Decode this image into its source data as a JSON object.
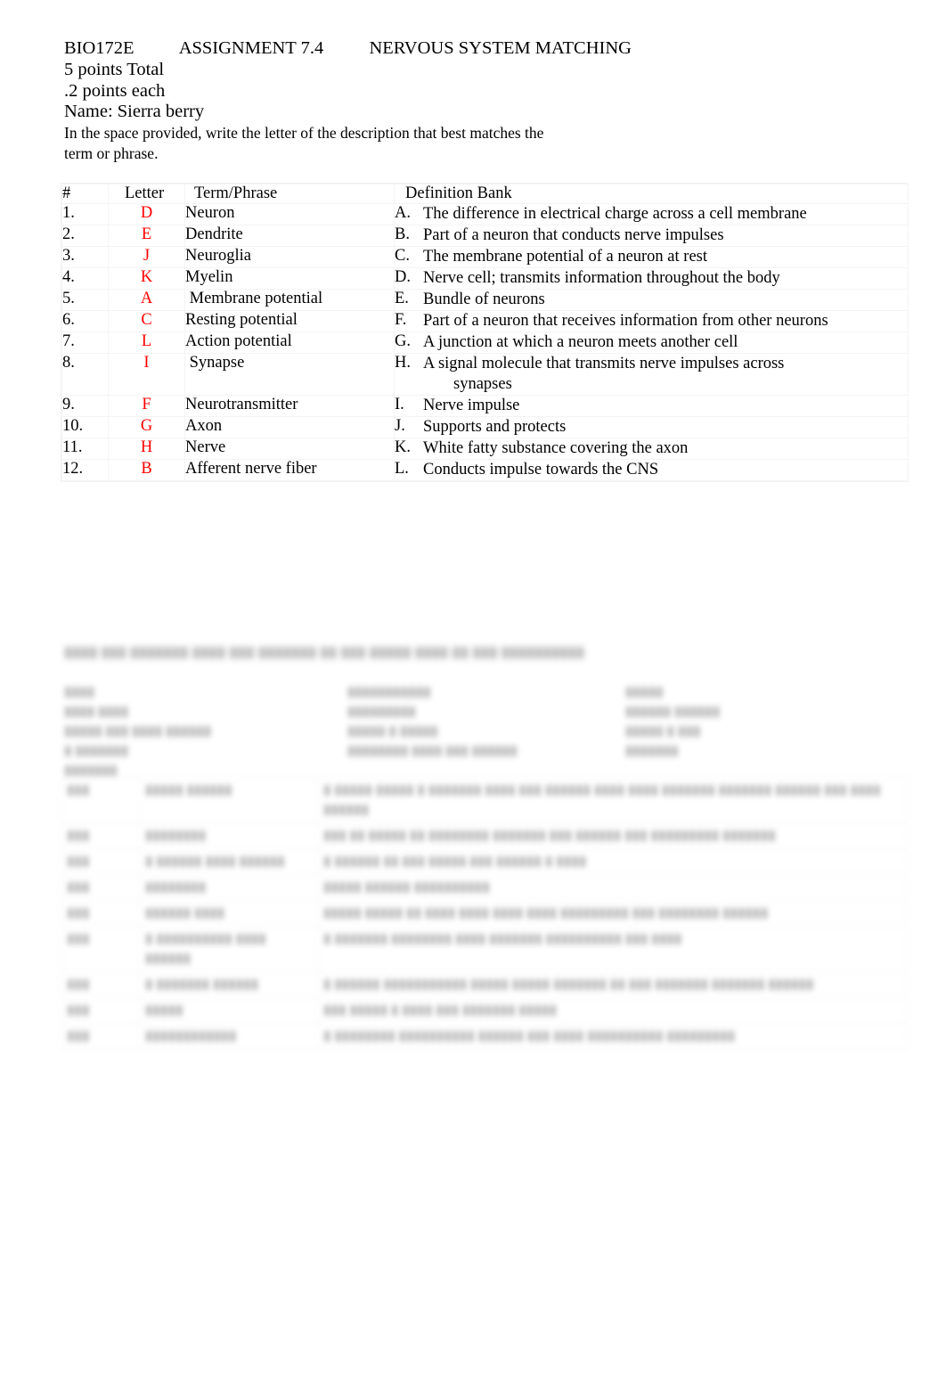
{
  "document": {
    "course_code": "BIO172E",
    "assignment": "ASSIGNMENT 7.4",
    "title": "NERVOUS SYSTEM MATCHING",
    "header_line_1": "BIO172E          ASSIGNMENT 7.4          NERVOUS SYSTEM MATCHING",
    "points_total": "5 points Total",
    "points_each": ".2 points each",
    "name_line": "Name: Sierra berry",
    "instructions_line_1": "In the space provided, write the letter of the description that best matches the",
    "instructions_line_2": "term or phrase."
  },
  "colors": {
    "answer_red": "#ff0000",
    "text_black": "#000000",
    "grid_line": "#f4f4f4"
  },
  "matching_table": {
    "headers": {
      "number": "#",
      "letter": "Letter",
      "term": "Term/Phrase",
      "definition_bank": "Definition Bank"
    },
    "rows": [
      {
        "number": "1.",
        "answer": "D",
        "term": "Neuron",
        "def_letter": "A.",
        "def_text": "The difference in electrical charge across a cell membrane",
        "def_indent": ""
      },
      {
        "number": "2.",
        "answer": "E",
        "term": "Dendrite",
        "def_letter": "B.",
        "def_text": "Part of a neuron that conducts nerve impulses",
        "def_indent": ""
      },
      {
        "number": "3.",
        "answer": "J",
        "term": "Neuroglia",
        "def_letter": "C.",
        "def_text": "The membrane potential of a neuron at rest",
        "def_indent": ""
      },
      {
        "number": "4.",
        "answer": "K",
        "term": "Myelin",
        "def_letter": "D.",
        "def_text": "Nerve cell; transmits information throughout the body",
        "def_indent": ""
      },
      {
        "number": "5.",
        "answer": "A",
        "term": " Membrane potential",
        "def_letter": "E.",
        "def_text": "Bundle of neurons",
        "def_indent": ""
      },
      {
        "number": "6.",
        "answer": "C",
        "term": "Resting potential",
        "def_letter": "F.",
        "def_text": "Part of a neuron that receives information from other neurons",
        "def_indent": ""
      },
      {
        "number": "7.",
        "answer": "L",
        "term": "Action potential",
        "def_letter": "G.",
        "def_text": "A junction at which a neuron meets another cell",
        "def_indent": ""
      },
      {
        "number": "8.",
        "answer": "I",
        "term": " Synapse",
        "def_letter": "H.",
        "def_text": "A signal molecule that transmits nerve impulses across",
        "def_indent": "synapses"
      },
      {
        "number": "9.",
        "answer": "F",
        "term": "Neurotransmitter",
        "def_letter": "I.",
        "def_text": "Nerve impulse",
        "def_indent": ""
      },
      {
        "number": "10.",
        "answer": "G",
        "term": "Axon",
        "def_letter": "J.",
        "def_text": "Supports and protects",
        "def_indent": ""
      },
      {
        "number": "11.",
        "answer": "H",
        "term": "Nerve",
        "def_letter": "K.",
        "def_text": "White fatty substance covering the axon",
        "def_indent": ""
      },
      {
        "number": "12.",
        "answer": "B",
        "term": "Afferent nerve fiber",
        "def_letter": "L.",
        "def_text": "Conducts impulse towards the CNS",
        "def_indent": ""
      }
    ]
  },
  "redacted_section": {
    "note": "▮▮▮▮ ▮▮▮ ▮▮▮▮▮▮▮ ▮▮▮▮ ▮▮▮ ▮▮▮▮▮▮▮ ▮▮ ▮▮▮ ▮▮▮▮▮ ▮▮▮▮ ▮▮ ▮▮▮ ▮▮▮▮▮▮▮▮▮▮",
    "wordbank_columns": [
      {
        "lines": [
          "▮▮▮▮",
          "▮▮▮▮ ▮▮▮▮",
          "▮▮▮▮▮ ▮▮▮ ▮▮▮▮ ▮▮▮▮▮▮",
          "▮ ▮▮▮▮▮▮▮",
          "▮▮▮▮▮▮▮"
        ]
      },
      {
        "lines": [
          "▮▮▮▮▮▮▮▮▮▮▮",
          "▮▮▮▮▮▮▮▮▮",
          "▮▮▮▮▮ ▮ ▮▮▮▮▮",
          "▮▮▮▮▮▮▮▮ ▮▮▮▮ ▮▮▮ ▮▮▮▮▮▮"
        ]
      },
      {
        "lines": [
          "▮▮▮▮▮",
          "▮▮▮▮▮▮ ▮▮▮▮▮▮",
          "▮▮▮▮▮ ▮ ▮▮▮",
          "▮▮▮▮▮▮▮"
        ]
      }
    ],
    "table_rows": [
      {
        "c1": "▮▮▮",
        "c2": "▮▮▮▮▮ ▮▮▮▮▮▮",
        "c3": "▮ ▮▮▮▮▮ ▮▮▮▮▮ ▮ ▮▮▮▮▮▮▮ ▮▮▮▮ ▮▮▮ ▮▮▮▮▮▮ ▮▮▮▮ ▮▮▮▮ ▮▮▮▮▮▮▮ ▮▮▮▮▮▮▮ ▮▮▮▮▮▮ ▮▮▮ ▮▮▮▮ ▮▮▮▮▮▮"
      },
      {
        "c1": "▮▮▮",
        "c2": "▮▮▮▮▮▮▮▮",
        "c3": "▮▮▮ ▮▮ ▮▮▮▮▮ ▮▮ ▮▮▮▮▮▮▮▮ ▮▮▮▮▮▮▮ ▮▮▮ ▮▮▮▮▮▮ ▮▮▮ ▮▮▮▮▮▮▮▮▮ ▮▮▮▮▮▮▮"
      },
      {
        "c1": "▮▮▮",
        "c2": "▮ ▮▮▮▮▮▮ ▮▮▮▮ ▮▮▮▮▮▮",
        "c3": "▮ ▮▮▮▮▮▮ ▮▮ ▮▮▮ ▮▮▮▮▮ ▮▮▮ ▮▮▮▮▮▮ ▮ ▮▮▮▮"
      },
      {
        "c1": "▮▮▮",
        "c2": "▮▮▮▮▮▮▮▮",
        "c3": "▮▮▮▮▮ ▮▮▮▮▮▮ ▮▮▮▮▮▮▮▮▮▮"
      },
      {
        "c1": "▮▮▮",
        "c2": "▮▮▮▮▮▮ ▮▮▮▮",
        "c3": "▮▮▮▮▮ ▮▮▮▮▮ ▮▮ ▮▮▮▮ ▮▮▮▮ ▮▮▮▮ ▮▮▮▮ ▮▮▮▮▮▮▮▮▮ ▮▮▮ ▮▮▮▮▮▮▮▮ ▮▮▮▮▮▮"
      },
      {
        "c1": "▮▮▮",
        "c2": "▮ ▮▮▮▮▮▮▮▮▮▮ ▮▮▮▮ ▮▮▮▮▮▮",
        "c3": "▮ ▮▮▮▮▮▮▮ ▮▮▮▮▮▮▮▮ ▮▮▮▮ ▮▮▮▮▮▮▮ ▮▮▮▮▮▮▮▮▮▮ ▮▮▮ ▮▮▮▮"
      },
      {
        "c1": "▮▮▮",
        "c2": "▮ ▮▮▮▮▮▮▮ ▮▮▮▮▮▮",
        "c3": "▮ ▮▮▮▮▮▮ ▮▮▮▮▮▮▮▮▮▮▮ ▮▮▮▮▮ ▮▮▮▮▮ ▮▮▮▮▮▮▮ ▮▮ ▮▮▮ ▮▮▮▮▮▮▮ ▮▮▮▮▮▮▮ ▮▮▮▮▮▮"
      },
      {
        "c1": "▮▮▮",
        "c2": "▮▮▮▮▮",
        "c3": "▮▮▮ ▮▮▮▮▮ ▮ ▮▮▮▮ ▮▮▮ ▮▮▮▮▮▮▮ ▮▮▮▮▮"
      },
      {
        "c1": "▮▮▮",
        "c2": "▮▮▮▮▮▮▮▮▮▮▮▮",
        "c3": "▮ ▮▮▮▮▮▮▮▮ ▮▮▮▮▮▮▮▮▮▮ ▮▮▮▮▮▮ ▮▮▮ ▮▮▮▮ ▮▮▮▮▮▮▮▮▮▮ ▮▮▮▮▮▮▮▮▮"
      }
    ]
  }
}
